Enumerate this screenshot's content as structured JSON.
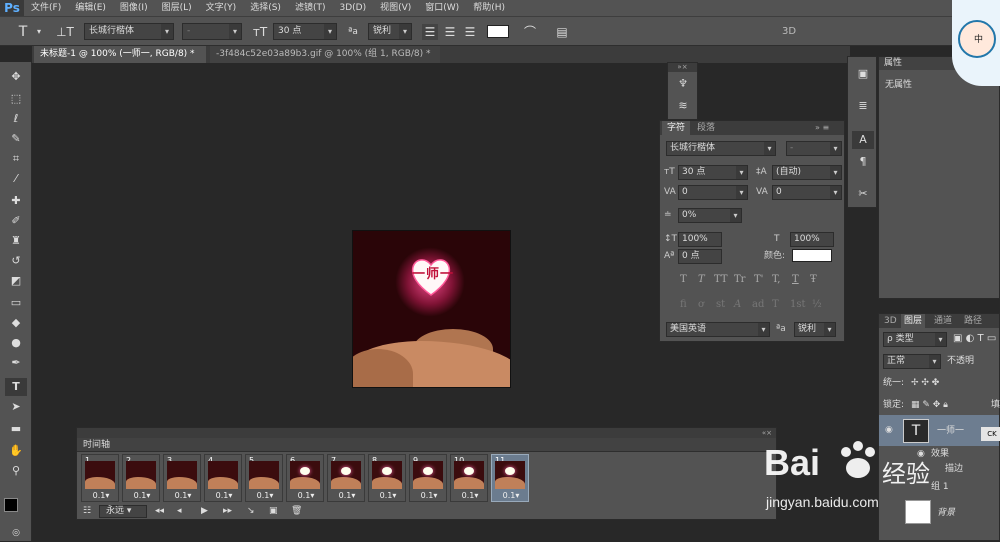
{
  "app": {
    "logo": "Ps"
  },
  "menu": [
    "文件(F)",
    "编辑(E)",
    "图像(I)",
    "图层(L)",
    "文字(Y)",
    "选择(S)",
    "滤镜(T)",
    "3D(D)",
    "视图(V)",
    "窗口(W)",
    "帮助(H)"
  ],
  "options": {
    "font_family": "长城行楷体",
    "font_style": "-",
    "font_size": "30 点",
    "antialias_prefix": "ªa",
    "antialias": "锐利",
    "label_3d": "3D"
  },
  "tabs": [
    {
      "label": "未标题-1 @ 100% (一师一, RGB/8) *"
    },
    {
      "label": "-3f484c52e03a89b3.gif @ 100% (组 1, RGB/8) *"
    }
  ],
  "document": {
    "heart_text": "一师一"
  },
  "character_panel": {
    "tab_char": "字符",
    "tab_para": "段落",
    "font_family": "长城行楷体",
    "font_style": "-",
    "size": "30 点",
    "leading": "(自动)",
    "kerning": "0",
    "tracking": "0",
    "tsume": "0%",
    "vscale": "100%",
    "hscale": "100%",
    "baseline": "0 点",
    "color_label": "颜色:",
    "language": "美国英语",
    "aa_prefix": "ªa",
    "antialias": "锐利",
    "style_buttons": [
      "T",
      "T",
      "TT",
      "Tr",
      "T'",
      "T,",
      "T",
      "Ŧ"
    ],
    "ot_buttons": [
      "fi",
      "ơ",
      "st",
      "A",
      "ad",
      "T",
      "1st",
      "½"
    ]
  },
  "properties": {
    "title": "属性",
    "body": "无属性"
  },
  "layers": {
    "tabs": [
      "3D",
      "图层",
      "通道",
      "路径"
    ],
    "filter": "ρ 类型",
    "blend": "正常",
    "opacity_label": "不透明",
    "unify": "统一:",
    "lock": "锁定:",
    "fill_label": "填",
    "layer_name": "一师一",
    "layer_badge": "CK",
    "effect": "效果",
    "stroke": "描边",
    "group": "组 1",
    "background": "背景"
  },
  "timeline": {
    "title": "时间轴",
    "loop": "永远",
    "frames": [
      {
        "num": "1",
        "dur": "0.1▾"
      },
      {
        "num": "2",
        "dur": "0.1▾"
      },
      {
        "num": "3",
        "dur": "0.1▾"
      },
      {
        "num": "4",
        "dur": "0.1▾"
      },
      {
        "num": "5",
        "dur": "0.1▾"
      },
      {
        "num": "6",
        "dur": "0.1▾"
      },
      {
        "num": "7",
        "dur": "0.1▾"
      },
      {
        "num": "8",
        "dur": "0.1▾"
      },
      {
        "num": "9",
        "dur": "0.1▾"
      },
      {
        "num": "10",
        "dur": "0.1▾"
      },
      {
        "num": "11",
        "dur": "0.1▾"
      }
    ],
    "selected_frame": 11
  },
  "watermark": {
    "bai": "Bai",
    "jingyan": "经验",
    "url": "jingyan.baidu.com"
  },
  "avatar": {
    "text": "中"
  },
  "colors": {
    "accent": "#5fb0ff",
    "heart_text": "#c0103a",
    "selected_frame": "#6b7c8f"
  }
}
